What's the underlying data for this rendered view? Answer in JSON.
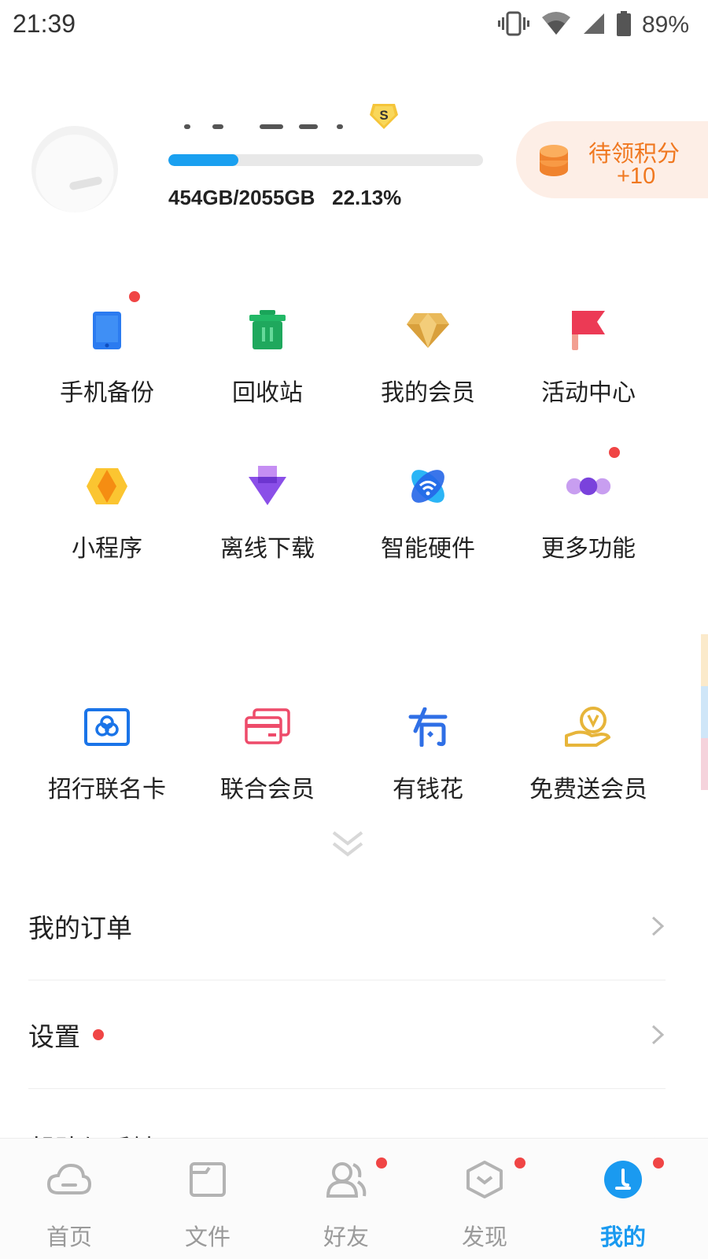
{
  "status_bar": {
    "time": "21:39",
    "battery": "89%"
  },
  "profile": {
    "storage_used_fraction": 0.2213,
    "storage_text": "454GB/2055GB   22.13%",
    "vip_badge_letter": "S"
  },
  "points": {
    "title": "待领积分",
    "value": "+10"
  },
  "grid": {
    "row1": [
      {
        "label": "手机备份",
        "icon": "phone-backup-icon",
        "dot": true
      },
      {
        "label": "回收站",
        "icon": "recycle-bin-icon",
        "dot": false
      },
      {
        "label": "我的会员",
        "icon": "diamond-icon",
        "dot": false
      },
      {
        "label": "活动中心",
        "icon": "flag-icon",
        "dot": false
      }
    ],
    "row2": [
      {
        "label": "小程序",
        "icon": "mini-program-icon",
        "dot": false
      },
      {
        "label": "离线下载",
        "icon": "offline-download-icon",
        "dot": false
      },
      {
        "label": "智能硬件",
        "icon": "smart-hardware-icon",
        "dot": false
      },
      {
        "label": "更多功能",
        "icon": "more-functions-icon",
        "dot": true
      }
    ],
    "row3": [
      {
        "label": "招行联名卡",
        "icon": "cmb-card-icon",
        "dot": false
      },
      {
        "label": "联合会员",
        "icon": "joint-membership-icon",
        "dot": false
      },
      {
        "label": "有钱花",
        "icon": "youqianhua-icon",
        "dot": false
      },
      {
        "label": "免费送会员",
        "icon": "free-vip-icon",
        "dot": false
      }
    ]
  },
  "menu": [
    {
      "label": "我的订单",
      "dot": false
    },
    {
      "label": "设置",
      "dot": true
    },
    {
      "label": "帮助与反馈",
      "dot": false
    }
  ],
  "bottom_nav": [
    {
      "label": "首页",
      "icon": "cloud-home-icon",
      "active": false,
      "dot": false
    },
    {
      "label": "文件",
      "icon": "folder-icon",
      "active": false,
      "dot": false
    },
    {
      "label": "好友",
      "icon": "friends-icon",
      "active": false,
      "dot": true
    },
    {
      "label": "发现",
      "icon": "discover-icon",
      "active": false,
      "dot": true
    },
    {
      "label": "我的",
      "icon": "profile-icon",
      "active": true,
      "dot": true
    }
  ],
  "colors": {
    "accent": "#1a9af0",
    "points_text": "#f07820",
    "points_bg": "#fdeee6",
    "notification_dot": "#f04545"
  }
}
